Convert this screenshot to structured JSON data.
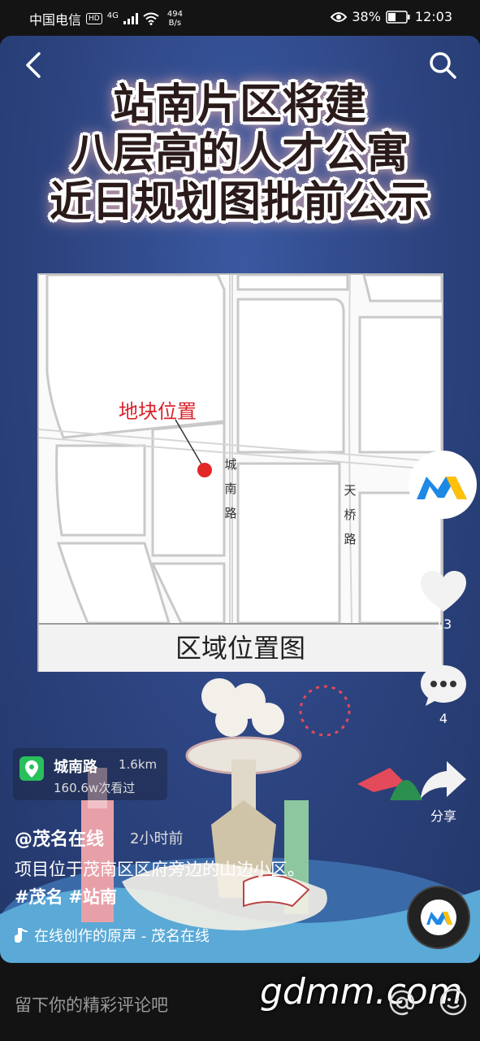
{
  "status_bar": {
    "carrier": "中国电信",
    "hd_badge": "HD",
    "network": "4G",
    "net_speed_value": "494",
    "net_speed_unit": "B/s",
    "battery": "38%",
    "time": "12:03"
  },
  "video": {
    "headline_lines": [
      "站南片区将建",
      "八层高的人才公寓",
      "近日规划图批前公示"
    ],
    "map": {
      "plot_label": "地块位置",
      "road_chengnan": [
        "城",
        "南",
        "路"
      ],
      "road_tianqiao": [
        "天",
        "桥",
        "路"
      ],
      "caption": "区域位置图",
      "marker_color": "#e32626"
    }
  },
  "sidebar": {
    "avatar_icon": "m-logo-icon",
    "like_count": "13",
    "comment_count": "4",
    "share_label": "分享"
  },
  "location": {
    "name": "城南路",
    "distance": "1.6km",
    "views": "160.6w次看过"
  },
  "post": {
    "author": "@茂名在线",
    "time_ago": "2小时前",
    "description_text": "项目位于茂南区区府旁边的山边小区。",
    "tags": [
      "#茂名",
      "#站南"
    ],
    "music": "在线创作的原声 - 茂名在线"
  },
  "bottom_bar": {
    "comment_placeholder": "留下你的精彩评论吧",
    "watermark": "gdmm.com"
  },
  "colors": {
    "video_bg": "#2f4685",
    "accent_green": "#29c05c",
    "marker_red": "#e32626"
  }
}
